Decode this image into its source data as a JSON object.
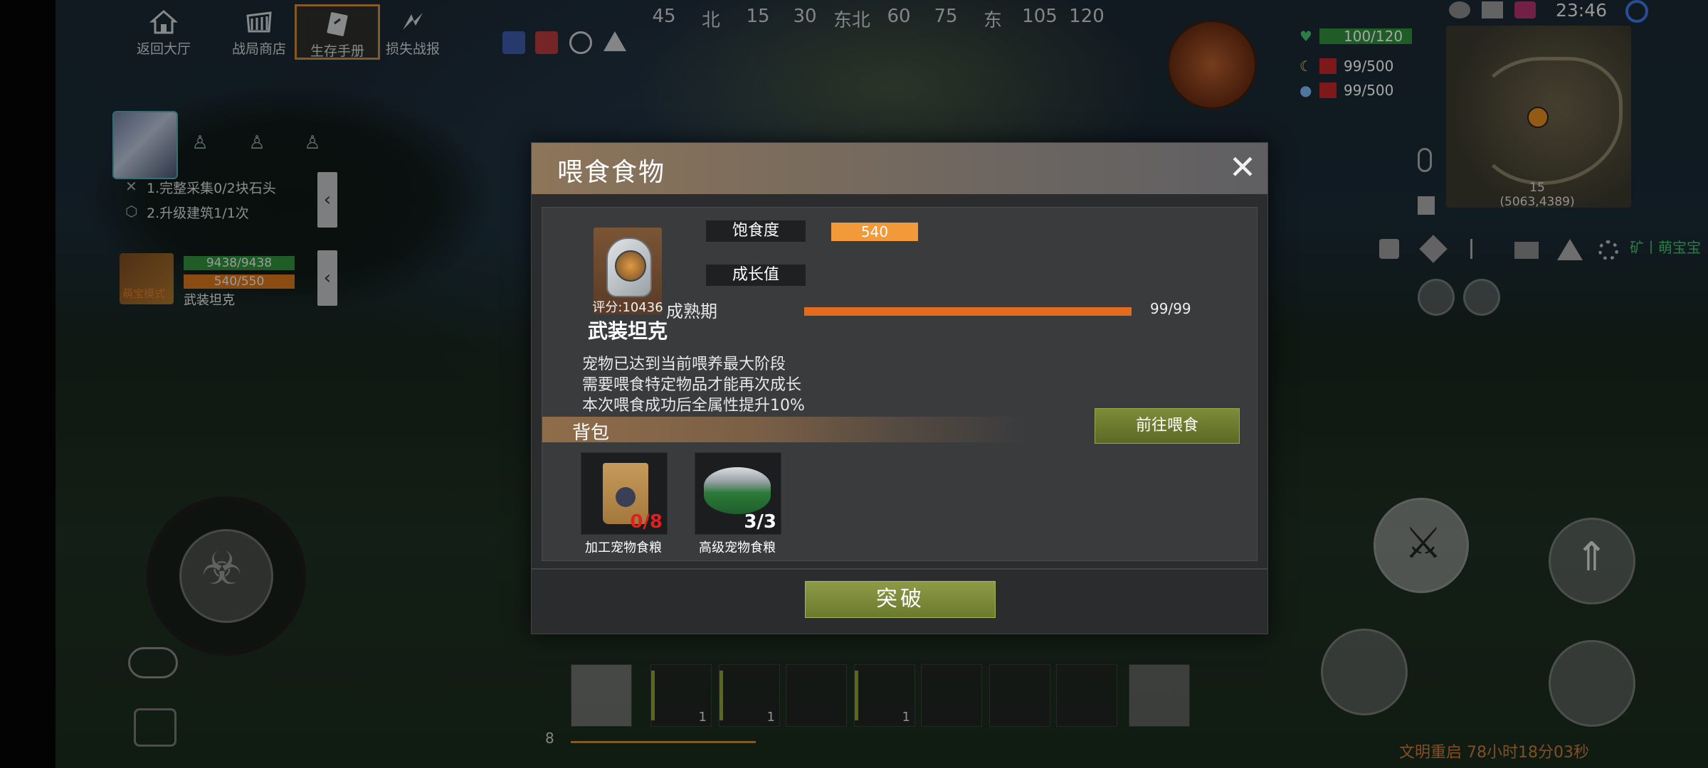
{
  "top_menu": [
    {
      "label": "返回大厅",
      "icon": "home-icon"
    },
    {
      "label": "战局商店",
      "icon": "shop-icon"
    },
    {
      "label": "生存手册",
      "icon": "manual-icon",
      "active": true
    },
    {
      "label": "损失战报",
      "icon": "loss-report-icon"
    }
  ],
  "compass": [
    "45",
    "北",
    "15",
    "30",
    "东北",
    "60",
    "75",
    "东",
    "105",
    "120"
  ],
  "quests": [
    "1.完整采集0/2块石头",
    "2.升级建筑1/1次"
  ],
  "pet_mini": {
    "hp": "9438/9438",
    "satiety": "540/550",
    "name": "武装坦克",
    "badge": "萌宝模式"
  },
  "stats": {
    "health": "100/120",
    "hunger": "99/500",
    "water": "99/500"
  },
  "clock": "23:46",
  "minimap": {
    "level": "15",
    "coords": "(5063,4389)"
  },
  "brand_label": "矿丨萌宝宝",
  "hotbar": {
    "counts": [
      "1",
      "1",
      "1"
    ],
    "page": "8"
  },
  "timer_text": "文明重启 78小时18分03秒",
  "dialog": {
    "title": "喂食食物",
    "pet_score": "评分:10436",
    "pet_name": "武装坦克",
    "satiety_label": "饱食度",
    "satiety_value": "540",
    "growth_label": "成长值",
    "mature_label": "成熟期",
    "mature_value": "99/99",
    "mature_progress": 1.0,
    "desc": [
      "宠物已达到当前喂养最大阶段",
      "需要喂食特定物品才能再次成长",
      "本次喂食成功后全属性提升10%"
    ],
    "bag_title": "背包",
    "goto_feed": "前往喂食",
    "items": [
      {
        "name": "加工宠物食粮",
        "count": "0/8",
        "count_color": "#e02020"
      },
      {
        "name": "高级宠物食粮",
        "count": "3/3",
        "count_color": "#ffffff"
      }
    ],
    "breakthrough": "突破"
  },
  "colors": {
    "accent_orange": "#f2993a",
    "progress_orange": "#e26b20",
    "button_green": "#7e8b3a",
    "hp_green": "#2f8f3a"
  }
}
